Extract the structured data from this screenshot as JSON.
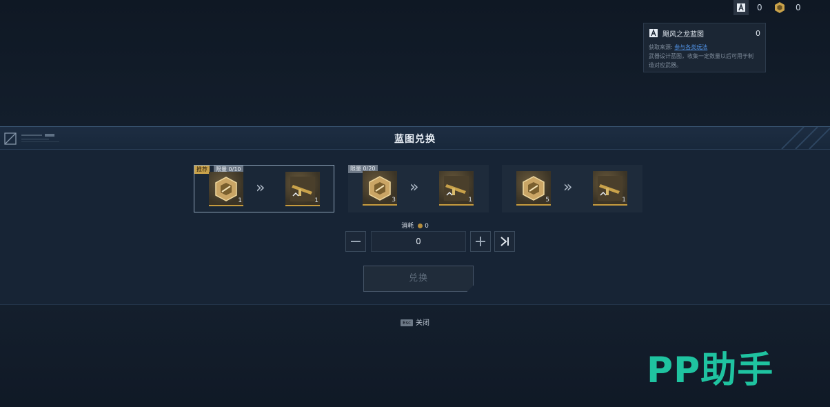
{
  "currencies": [
    {
      "icon": "blueprint-icon",
      "value": "0"
    },
    {
      "icon": "coin-icon",
      "value": "0"
    }
  ],
  "tooltip": {
    "name": "飓风之龙蓝图",
    "count": "0",
    "source_label": "获取来源:",
    "source_link": "参与各类玩法",
    "description_line1": "武器设计蓝图，收集一定数量以后可用于制",
    "description_line2": "造对应武器。"
  },
  "panel": {
    "title": "蓝图兑换"
  },
  "offers": [
    {
      "recommended": "推荐",
      "limit": "限量 0/10",
      "cost_qty": "1",
      "reward_qty": "1"
    },
    {
      "limit": "限量 0/20",
      "cost_qty": "3",
      "reward_qty": "1"
    },
    {
      "cost_qty": "5",
      "reward_qty": "1"
    }
  ],
  "consume": {
    "label": "消耗",
    "value": "0"
  },
  "quantity": {
    "value": "0"
  },
  "exchange_button": "兑换",
  "close_hint": {
    "key": "Esc",
    "label": "关闭"
  },
  "watermark": "PP助手",
  "colors": {
    "accent_gold": "#c9a24a",
    "watermark": "#1fc3a0",
    "panel_bg": "#172435"
  }
}
